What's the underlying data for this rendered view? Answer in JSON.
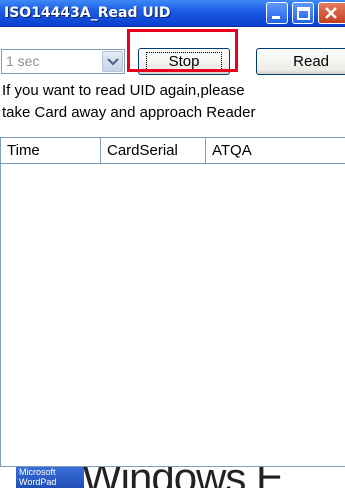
{
  "window": {
    "title": "ISO14443A_Read UID"
  },
  "controls": {
    "interval_value": "1  sec",
    "stop_label": "Stop",
    "read_label": "Read"
  },
  "notice": {
    "line1": "If you want to read UID again,please",
    "line2": "take Card away and approach Reader"
  },
  "list": {
    "columns": [
      "Time",
      "CardSerial",
      "ATQA"
    ]
  },
  "taskbar": {
    "app_line1": "Microsoft",
    "app_line2": "WordPad",
    "brand_text": "Windows E"
  },
  "colors": {
    "titlebar": "#1e5ee6",
    "highlight": "#e8001e"
  }
}
